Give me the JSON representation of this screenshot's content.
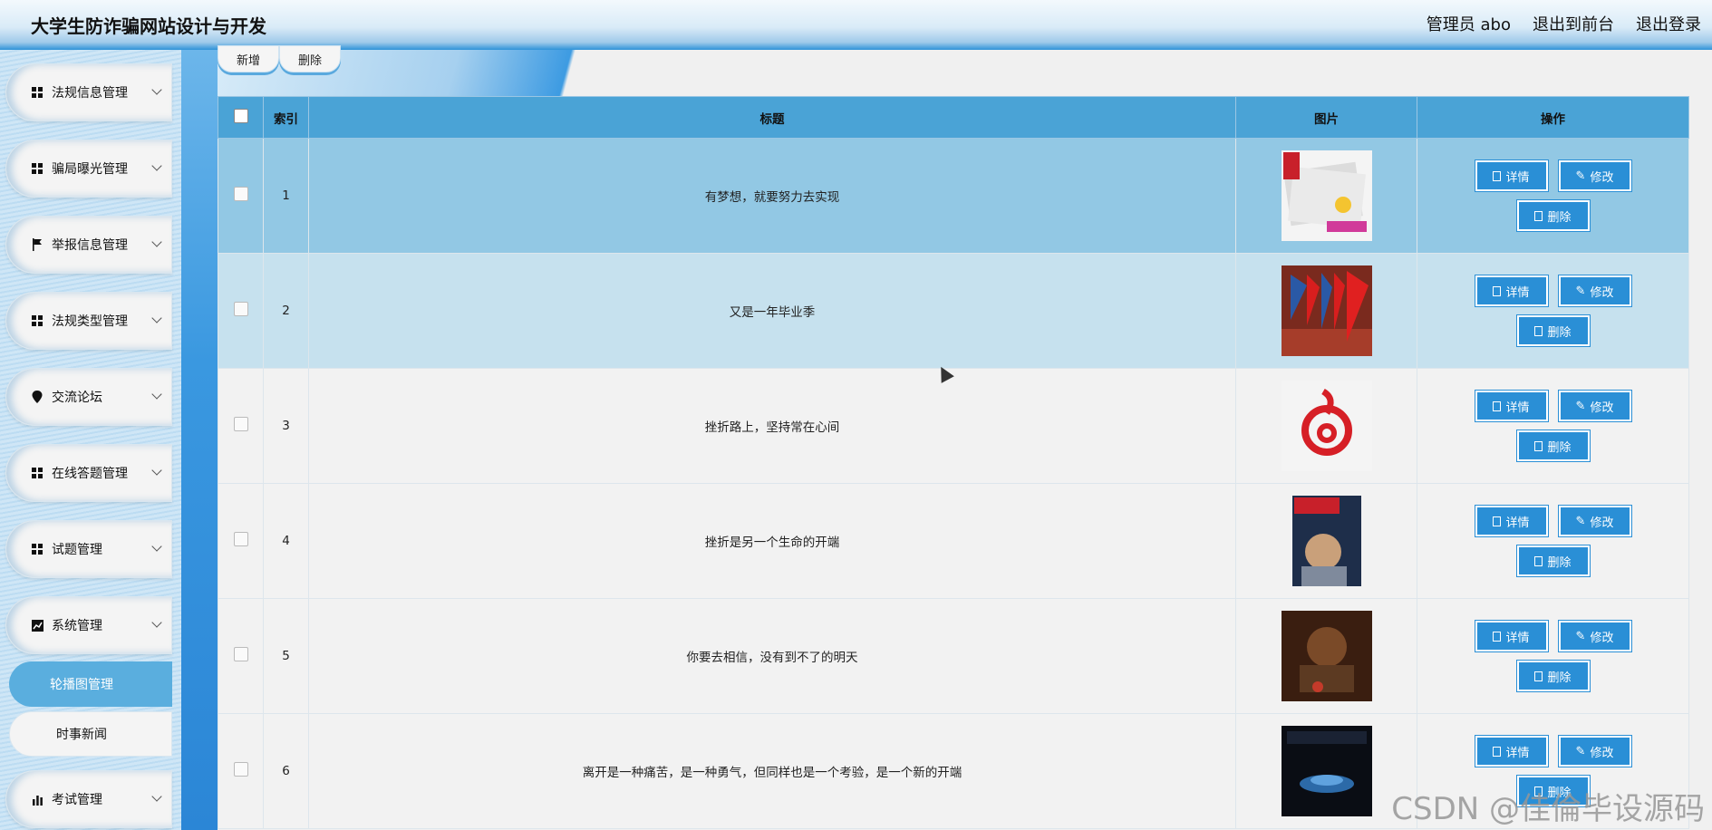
{
  "header": {
    "title": "大学生防诈骗网站设计与开发",
    "nav": [
      "管理员 abo",
      "退出到前台",
      "退出登录"
    ]
  },
  "sidebar": {
    "items": [
      {
        "label": "法规信息管理",
        "icon": "grid-icon"
      },
      {
        "label": "骗局曝光管理",
        "icon": "grid-icon"
      },
      {
        "label": "举报信息管理",
        "icon": "flag-icon"
      },
      {
        "label": "法规类型管理",
        "icon": "grid-icon"
      },
      {
        "label": "交流论坛",
        "icon": "location-pin-icon"
      },
      {
        "label": "在线答题管理",
        "icon": "grid-icon"
      },
      {
        "label": "试题管理",
        "icon": "grid-icon"
      },
      {
        "label": "系统管理",
        "icon": "chart-icon"
      }
    ],
    "subitems": [
      {
        "label": "轮播图管理",
        "active": true
      },
      {
        "label": "时事新闻",
        "active": false
      }
    ],
    "last_item": {
      "label": "考试管理",
      "icon": "bar-chart-icon"
    }
  },
  "toolbar": {
    "add_label": "新增",
    "delete_label": "删除"
  },
  "table": {
    "headers": [
      "索引",
      "标题",
      "图片",
      "操作"
    ],
    "rows": [
      {
        "index": "1",
        "title": "有梦想，就要努力去实现",
        "image": "newspaper-stack-image"
      },
      {
        "index": "2",
        "title": "又是一年毕业季",
        "image": "flags-image"
      },
      {
        "index": "3",
        "title": "挫折路上，坚持常在心间",
        "image": "red-logo-image"
      },
      {
        "index": "4",
        "title": "挫折是另一个生命的开端",
        "image": "magazine-cover-image"
      },
      {
        "index": "5",
        "title": "你要去相信，没有到不了的明天",
        "image": "movie-poster-image"
      },
      {
        "index": "6",
        "title": "离开是一种痛苦，是一种勇气，但同样也是一个考验，是一个新的开端",
        "image": "car-poster-image"
      }
    ],
    "actions": {
      "detail": "详情",
      "edit": "修改",
      "delete": "删除"
    }
  },
  "watermark": "CSDN @佳倫毕设源码",
  "colors": {
    "header_accent": "#2f93d8",
    "table_header": "#4aa3d6",
    "action_button": "#2a8fd6",
    "active_sub": "#5aaede"
  }
}
